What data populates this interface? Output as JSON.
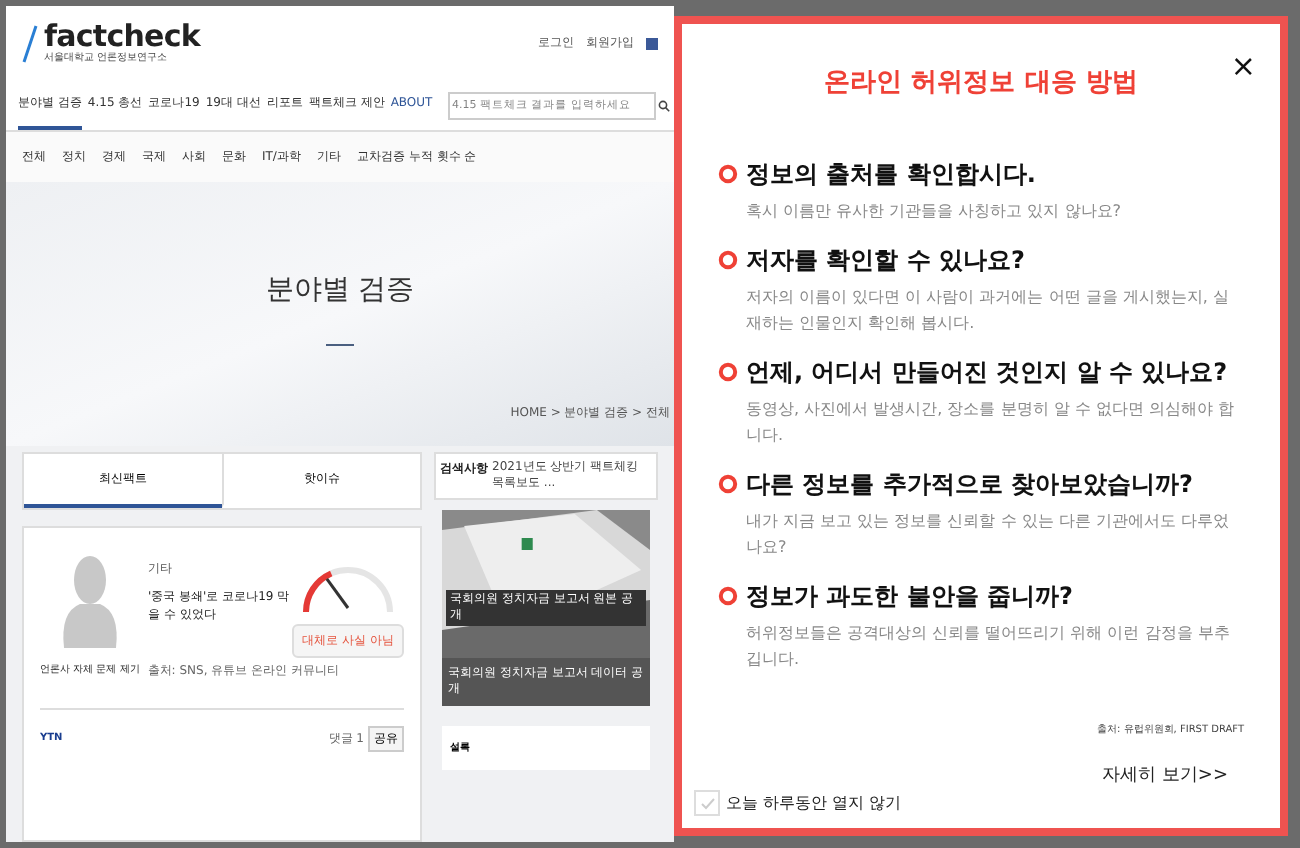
{
  "site": {
    "logo": "factcheck",
    "logo_subtitle": "서울대학교 언론정보연구소",
    "header_links": [
      "로그인",
      "회원가입"
    ],
    "nav": [
      {
        "label": "분야별 검증",
        "selected": true
      },
      {
        "label": "4.15 총선",
        "selected": false
      },
      {
        "label": "코로나19",
        "selected": false
      },
      {
        "label": "19대 대선",
        "selected": false
      },
      {
        "label": "리포트",
        "selected": false
      },
      {
        "label": "팩트체크 제안",
        "selected": false
      },
      {
        "label": "ABOUT",
        "selected": false
      }
    ],
    "search": {
      "placeholder": "4.15 팩트체크 결과를 입력하세요"
    },
    "categories": [
      "전체",
      "정치",
      "경제",
      "국제",
      "사회",
      "문화",
      "IT/과학",
      "기타",
      "교차검증 누적 횟수 순"
    ],
    "hero_title": "분야별 검증",
    "breadcrumb": "HOME > 분야별 검증 > 전체",
    "tabs": [
      {
        "label": "최신팩트",
        "selected": true
      },
      {
        "label": "핫이슈",
        "selected": false
      }
    ],
    "card": {
      "category": "기타",
      "claim": "'중국 봉쇄'로 코로나19 막을 수 있었다",
      "speaker": "언론사 자체 문제 제기",
      "source": "출처: SNS, 유튜브 온라인 커뮤니티",
      "verdict": "대체로 사실 아님",
      "level": 0.3,
      "outlet": "YTN",
      "comments": "댓글 1",
      "share": "공유"
    },
    "side": {
      "label": "검색사항",
      "headline": "2021년도 상반기 팩트체킹 목록보도 ...",
      "photo_caption": "국회의원 정치자금 보고서 원본 공개",
      "photo_subtitle": "국회의원 정치자금 보고서 데이터 공개",
      "next_label": "설록"
    }
  },
  "popup": {
    "title": "온라인 허위정보 대응 방법",
    "close": "×",
    "items": [
      {
        "heading": "정보의 출처를 확인합시다.",
        "text": "혹시 이름만 유사한 기관들을 사칭하고 있지 않나요?"
      },
      {
        "heading": "저자를 확인할 수 있나요?",
        "text": "저자의 이름이 있다면 이 사람이 과거에는 어떤 글을 게시했는지, 실재하는 인물인지 확인해 봅시다."
      },
      {
        "heading": "언제, 어디서 만들어진 것인지 알 수 있나요?",
        "text": "동영상, 사진에서 발생시간, 장소를 분명히 알 수 없다면 의심해야 합니다."
      },
      {
        "heading": "다른 정보를 추가적으로 찾아보았습니까?",
        "text": "내가 지금 보고 있는 정보를 신뢰할 수 있는 다른 기관에서도 다루었나요?"
      },
      {
        "heading": "정보가 과도한 불안을 줍니까?",
        "text": "허위정보들은 공격대상의 신뢰를 떨어뜨리기 위해 이런 감정을 부추깁니다."
      }
    ],
    "source": "출처: 유럽위원회, FIRST DRAFT",
    "more_link": "자세히 보기>>",
    "dismiss": {
      "label": "오늘 하루동안 열지 않기",
      "checked": false
    }
  }
}
